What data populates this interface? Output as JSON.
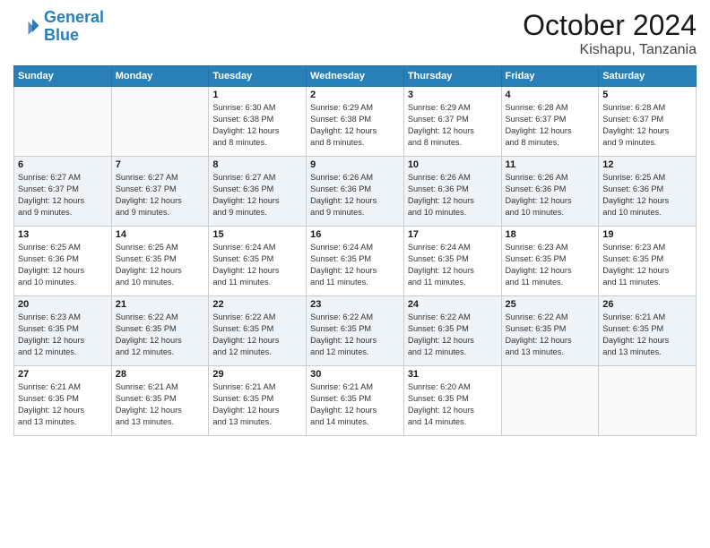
{
  "header": {
    "logo_line1": "General",
    "logo_line2": "Blue",
    "month_title": "October 2024",
    "location": "Kishapu, Tanzania"
  },
  "weekdays": [
    "Sunday",
    "Monday",
    "Tuesday",
    "Wednesday",
    "Thursday",
    "Friday",
    "Saturday"
  ],
  "weeks": [
    [
      {
        "day": "",
        "info": ""
      },
      {
        "day": "",
        "info": ""
      },
      {
        "day": "1",
        "info": "Sunrise: 6:30 AM\nSunset: 6:38 PM\nDaylight: 12 hours\nand 8 minutes."
      },
      {
        "day": "2",
        "info": "Sunrise: 6:29 AM\nSunset: 6:38 PM\nDaylight: 12 hours\nand 8 minutes."
      },
      {
        "day": "3",
        "info": "Sunrise: 6:29 AM\nSunset: 6:37 PM\nDaylight: 12 hours\nand 8 minutes."
      },
      {
        "day": "4",
        "info": "Sunrise: 6:28 AM\nSunset: 6:37 PM\nDaylight: 12 hours\nand 8 minutes."
      },
      {
        "day": "5",
        "info": "Sunrise: 6:28 AM\nSunset: 6:37 PM\nDaylight: 12 hours\nand 9 minutes."
      }
    ],
    [
      {
        "day": "6",
        "info": "Sunrise: 6:27 AM\nSunset: 6:37 PM\nDaylight: 12 hours\nand 9 minutes."
      },
      {
        "day": "7",
        "info": "Sunrise: 6:27 AM\nSunset: 6:37 PM\nDaylight: 12 hours\nand 9 minutes."
      },
      {
        "day": "8",
        "info": "Sunrise: 6:27 AM\nSunset: 6:36 PM\nDaylight: 12 hours\nand 9 minutes."
      },
      {
        "day": "9",
        "info": "Sunrise: 6:26 AM\nSunset: 6:36 PM\nDaylight: 12 hours\nand 9 minutes."
      },
      {
        "day": "10",
        "info": "Sunrise: 6:26 AM\nSunset: 6:36 PM\nDaylight: 12 hours\nand 10 minutes."
      },
      {
        "day": "11",
        "info": "Sunrise: 6:26 AM\nSunset: 6:36 PM\nDaylight: 12 hours\nand 10 minutes."
      },
      {
        "day": "12",
        "info": "Sunrise: 6:25 AM\nSunset: 6:36 PM\nDaylight: 12 hours\nand 10 minutes."
      }
    ],
    [
      {
        "day": "13",
        "info": "Sunrise: 6:25 AM\nSunset: 6:36 PM\nDaylight: 12 hours\nand 10 minutes."
      },
      {
        "day": "14",
        "info": "Sunrise: 6:25 AM\nSunset: 6:35 PM\nDaylight: 12 hours\nand 10 minutes."
      },
      {
        "day": "15",
        "info": "Sunrise: 6:24 AM\nSunset: 6:35 PM\nDaylight: 12 hours\nand 11 minutes."
      },
      {
        "day": "16",
        "info": "Sunrise: 6:24 AM\nSunset: 6:35 PM\nDaylight: 12 hours\nand 11 minutes."
      },
      {
        "day": "17",
        "info": "Sunrise: 6:24 AM\nSunset: 6:35 PM\nDaylight: 12 hours\nand 11 minutes."
      },
      {
        "day": "18",
        "info": "Sunrise: 6:23 AM\nSunset: 6:35 PM\nDaylight: 12 hours\nand 11 minutes."
      },
      {
        "day": "19",
        "info": "Sunrise: 6:23 AM\nSunset: 6:35 PM\nDaylight: 12 hours\nand 11 minutes."
      }
    ],
    [
      {
        "day": "20",
        "info": "Sunrise: 6:23 AM\nSunset: 6:35 PM\nDaylight: 12 hours\nand 12 minutes."
      },
      {
        "day": "21",
        "info": "Sunrise: 6:22 AM\nSunset: 6:35 PM\nDaylight: 12 hours\nand 12 minutes."
      },
      {
        "day": "22",
        "info": "Sunrise: 6:22 AM\nSunset: 6:35 PM\nDaylight: 12 hours\nand 12 minutes."
      },
      {
        "day": "23",
        "info": "Sunrise: 6:22 AM\nSunset: 6:35 PM\nDaylight: 12 hours\nand 12 minutes."
      },
      {
        "day": "24",
        "info": "Sunrise: 6:22 AM\nSunset: 6:35 PM\nDaylight: 12 hours\nand 12 minutes."
      },
      {
        "day": "25",
        "info": "Sunrise: 6:22 AM\nSunset: 6:35 PM\nDaylight: 12 hours\nand 13 minutes."
      },
      {
        "day": "26",
        "info": "Sunrise: 6:21 AM\nSunset: 6:35 PM\nDaylight: 12 hours\nand 13 minutes."
      }
    ],
    [
      {
        "day": "27",
        "info": "Sunrise: 6:21 AM\nSunset: 6:35 PM\nDaylight: 12 hours\nand 13 minutes."
      },
      {
        "day": "28",
        "info": "Sunrise: 6:21 AM\nSunset: 6:35 PM\nDaylight: 12 hours\nand 13 minutes."
      },
      {
        "day": "29",
        "info": "Sunrise: 6:21 AM\nSunset: 6:35 PM\nDaylight: 12 hours\nand 13 minutes."
      },
      {
        "day": "30",
        "info": "Sunrise: 6:21 AM\nSunset: 6:35 PM\nDaylight: 12 hours\nand 14 minutes."
      },
      {
        "day": "31",
        "info": "Sunrise: 6:20 AM\nSunset: 6:35 PM\nDaylight: 12 hours\nand 14 minutes."
      },
      {
        "day": "",
        "info": ""
      },
      {
        "day": "",
        "info": ""
      }
    ]
  ]
}
